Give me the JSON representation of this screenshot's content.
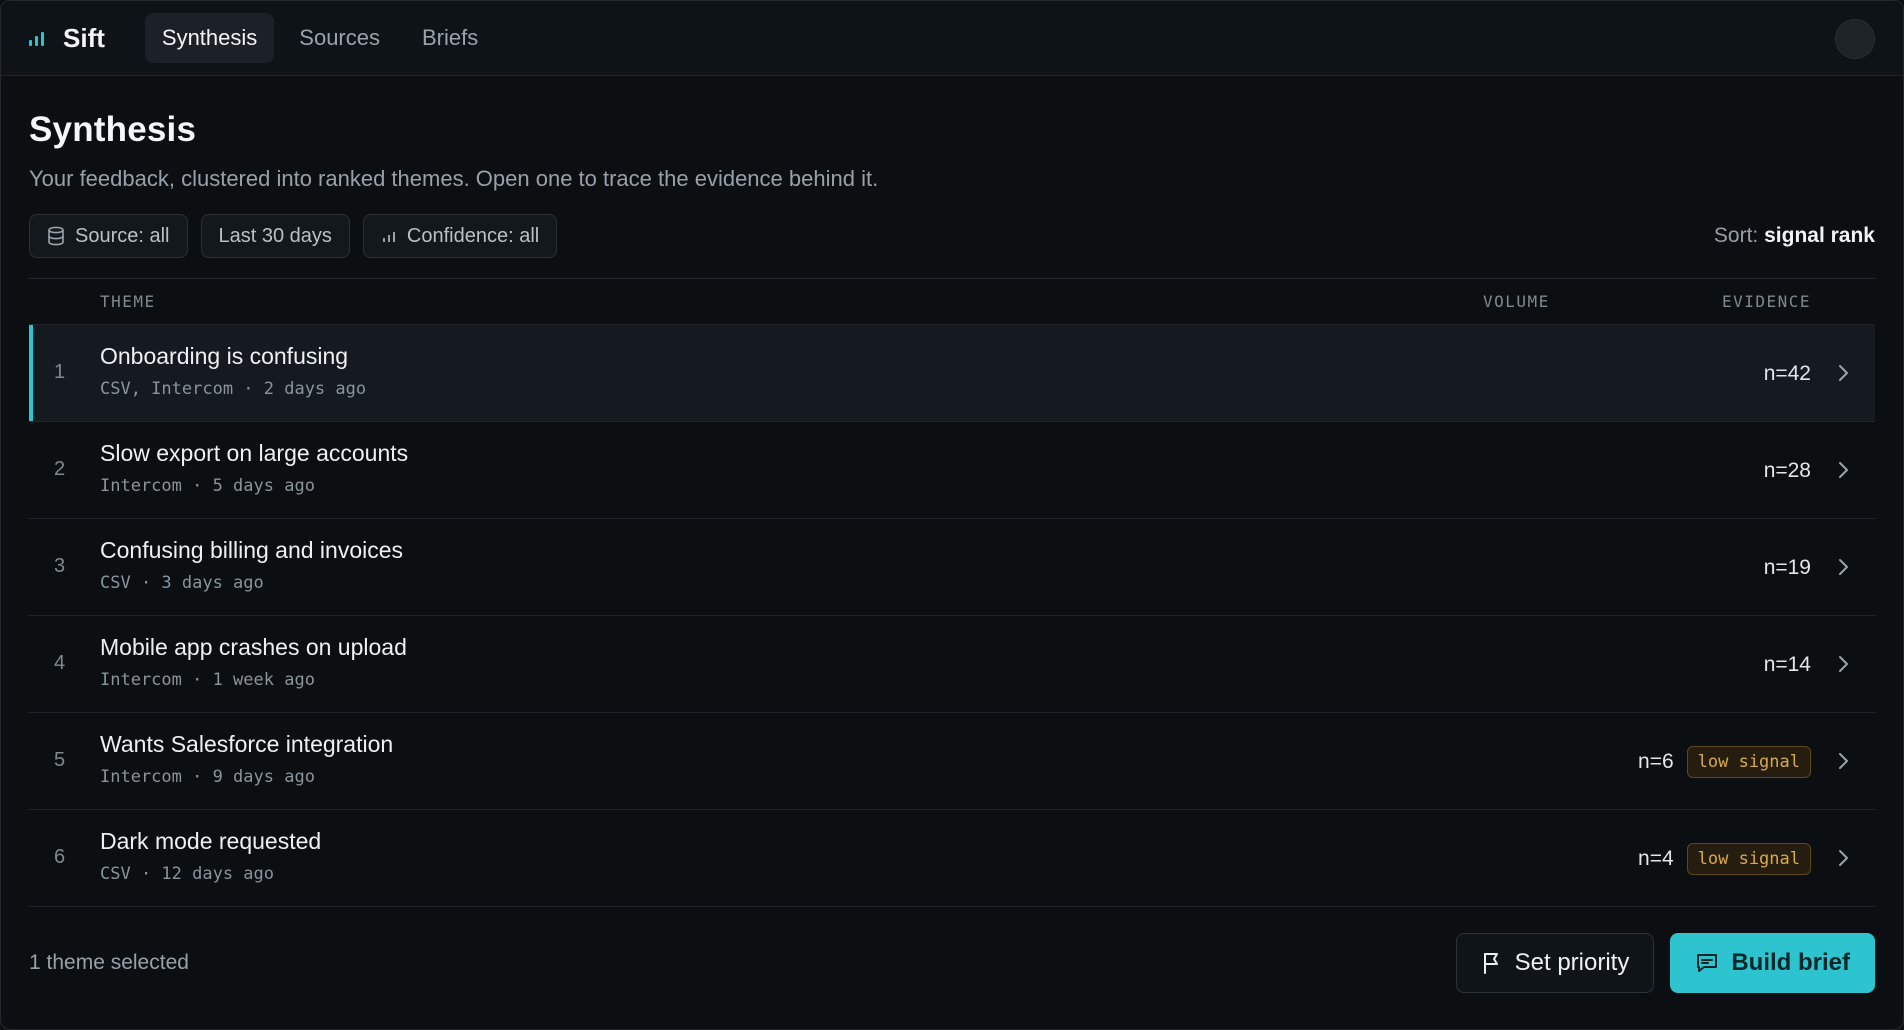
{
  "app": {
    "name": "Sift"
  },
  "nav": {
    "tabs": [
      {
        "label": "Synthesis",
        "active": true
      },
      {
        "label": "Sources",
        "active": false
      },
      {
        "label": "Briefs",
        "active": false
      }
    ]
  },
  "page": {
    "title": "Synthesis",
    "subtitle": "Your feedback, clustered into ranked themes. Open one to trace the evidence behind it."
  },
  "filters": {
    "source": "Source: all",
    "period": "Last 30 days",
    "confidence": "Confidence: all",
    "sort_label": "Sort:",
    "sort_value": "signal rank"
  },
  "table": {
    "headers": {
      "theme": "THEME",
      "volume": "VOLUME",
      "evidence": "EVIDENCE"
    },
    "rows": [
      {
        "rank": "1",
        "title": "Onboarding is confusing",
        "meta": "CSV, Intercom · 2 days ago",
        "count": "n=42",
        "badge": "",
        "selected": true
      },
      {
        "rank": "2",
        "title": "Slow export on large accounts",
        "meta": "Intercom · 5 days ago",
        "count": "n=28",
        "badge": ""
      },
      {
        "rank": "3",
        "title": "Confusing billing and invoices",
        "meta": "CSV · 3 days ago",
        "count": "n=19",
        "badge": ""
      },
      {
        "rank": "4",
        "title": "Mobile app crashes on upload",
        "meta": "Intercom · 1 week ago",
        "count": "n=14",
        "badge": ""
      },
      {
        "rank": "5",
        "title": "Wants Salesforce integration",
        "meta": "Intercom · 9 days ago",
        "count": "n=6",
        "badge": "low signal"
      },
      {
        "rank": "6",
        "title": "Dark mode requested",
        "meta": "CSV · 12 days ago",
        "count": "n=4",
        "badge": "low signal"
      }
    ]
  },
  "footer": {
    "selection": "1 theme selected",
    "set_priority": "Set priority",
    "build_brief": "Build brief"
  },
  "colors": {
    "accent": "#2ec4cf",
    "background": "#0b0f12",
    "warning": "#d9a94e"
  },
  "icons": {
    "brand": "bar-chart-icon",
    "source_filter": "database-icon",
    "confidence_filter": "bar-chart-icon",
    "row_action": "chevron-right-icon",
    "set_priority": "flag-icon",
    "build_brief": "message-icon"
  }
}
